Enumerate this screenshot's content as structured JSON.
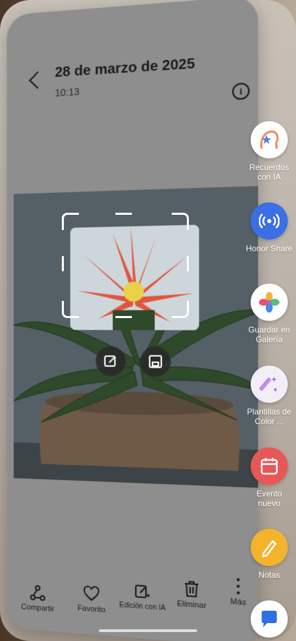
{
  "header": {
    "date": "28 de marzo de 2025",
    "time": "10:13",
    "info_icon": "info-icon"
  },
  "photo": {
    "subject": "plant-image"
  },
  "crop_actions": [
    "edit-icon",
    "save-icon"
  ],
  "bottom_bar": [
    {
      "label": "Compartir",
      "icon": "share-icon"
    },
    {
      "label": "Favorito",
      "icon": "heart-icon"
    },
    {
      "label": "Edición con IA",
      "icon": "ai-edit-icon"
    },
    {
      "label": "Eliminar",
      "icon": "trash-icon"
    },
    {
      "label": "Más",
      "icon": "more-icon"
    }
  ],
  "side_panel": [
    {
      "label": "Recuerdos con IA",
      "icon": "ai-memories-icon",
      "color": "#ffffff"
    },
    {
      "label": "Honor Share",
      "icon": "honor-share-icon",
      "color": "#3b6fe6"
    },
    {
      "label": "Guardar en Galería",
      "icon": "gallery-icon",
      "color": "#ffffff"
    },
    {
      "label": "Plantillas de Color ...",
      "icon": "color-templates-icon",
      "color": "#f2eef8"
    },
    {
      "label": "Evento nuevo",
      "icon": "calendar-icon",
      "color": "#e85656"
    },
    {
      "label": "Notas",
      "icon": "notes-icon",
      "color": "#f3b32a"
    },
    {
      "label": "",
      "icon": "messages-icon",
      "color": "#ffffff"
    }
  ]
}
